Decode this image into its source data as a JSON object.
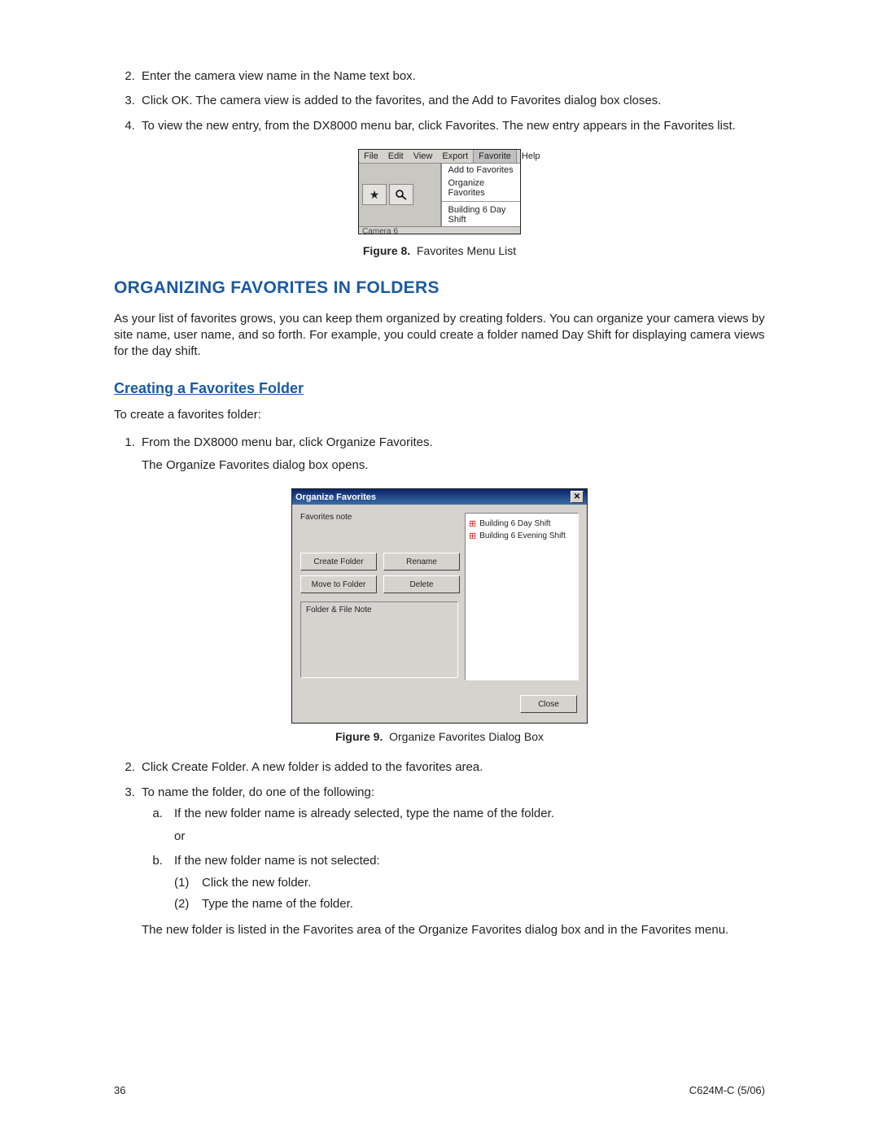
{
  "steps_top": [
    "Enter the camera view name in the Name text box.",
    "Click OK. The camera view is added to the favorites, and the Add to Favorites dialog box closes.",
    "To view the new entry, from the DX8000 menu bar, click Favorites. The new entry appears in the Favorites list."
  ],
  "figure8": {
    "menubar": [
      "File",
      "Edit",
      "View",
      "Export",
      "Favorite",
      "Help"
    ],
    "dropdown": {
      "items_top": [
        "Add to Favorites",
        "Organize Favorites"
      ],
      "item_bottom": "Building 6 Day Shift"
    },
    "tab_hint": "Camera 6",
    "caption_prefix": "Figure 8.",
    "caption_text": "Favorites Menu List"
  },
  "heading1": "ORGANIZING FAVORITES IN FOLDERS",
  "para1": "As your list of favorites grows, you can keep them organized by creating folders. You can organize your camera views by site name, user name, and so forth. For example, you could create a folder named Day Shift for displaying camera views for the day shift.",
  "heading2": "Creating a Favorites Folder",
  "para2": "To create a favorites folder:",
  "steps_mid": {
    "s1": "From the DX8000 menu bar, click Organize Favorites.",
    "s1_sub": "The Organize Favorites dialog box opens."
  },
  "figure9": {
    "title": "Organize Favorites",
    "label_favnote": "Favorites note",
    "buttons": {
      "create": "Create Folder",
      "rename": "Rename",
      "move": "Move to Folder",
      "delete": "Delete"
    },
    "label_filenote": "Folder & File Note",
    "tree_items": [
      "Building 6 Day Shift",
      "Building 6 Evening Shift"
    ],
    "close": "Close",
    "caption_prefix": "Figure 9.",
    "caption_text": "Organize Favorites Dialog Box"
  },
  "steps_bottom": {
    "s2": "Click Create Folder. A new folder is added to the favorites area.",
    "s3": "To name the folder, do one of the following:",
    "s3a": "If the new folder name is already selected, type the name of the folder.",
    "s3a_or": "or",
    "s3b": "If the new folder name is not selected:",
    "s3b_1_marker": "(1)",
    "s3b_1": "Click the new folder.",
    "s3b_2_marker": "(2)",
    "s3b_2": "Type the name of the folder.",
    "tail": "The new folder is listed in the Favorites area of the Organize Favorites dialog box and in the Favorites menu."
  },
  "footer": {
    "page": "36",
    "docid": "C624M-C (5/06)"
  }
}
